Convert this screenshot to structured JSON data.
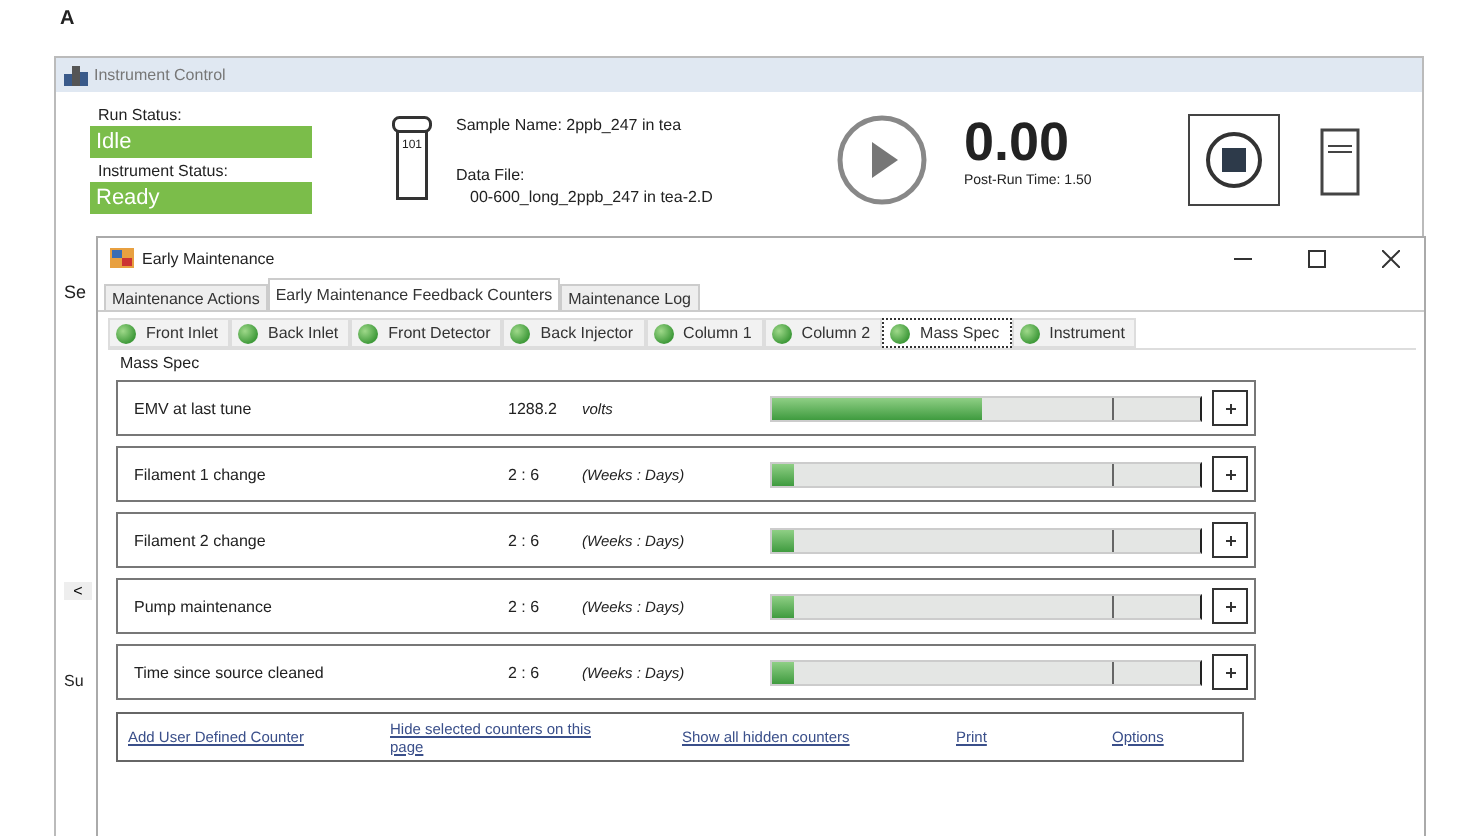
{
  "figure_label": "A",
  "window": {
    "title": "Instrument Control"
  },
  "run_status": {
    "label": "Run Status:",
    "value": "Idle"
  },
  "instrument_status": {
    "label": "Instrument Status:",
    "value": "Ready"
  },
  "vial": {
    "number": "101"
  },
  "sample_name": "Sample Name: 2ppb_247 in tea",
  "data_file": {
    "label": "Data File:",
    "value": "00-600_long_2ppb_247 in tea-2.D"
  },
  "timer": {
    "value": "0.00",
    "post_run": "Post-Run Time: 1.50"
  },
  "background_fragments": {
    "top": "Se",
    "scroll": "<",
    "bottom": "Su"
  },
  "dialog": {
    "title": "Early Maintenance",
    "tabs": [
      {
        "label": "Maintenance Actions",
        "selected": false
      },
      {
        "label": "Early Maintenance Feedback Counters",
        "selected": true
      },
      {
        "label": "Maintenance Log",
        "selected": false
      }
    ],
    "module_tabs": [
      {
        "label": "Front Inlet",
        "selected": false
      },
      {
        "label": "Back Inlet",
        "selected": false
      },
      {
        "label": "Front Detector",
        "selected": false
      },
      {
        "label": "Back Injector",
        "selected": false
      },
      {
        "label": "Column 1",
        "selected": false
      },
      {
        "label": "Column 2",
        "selected": false
      },
      {
        "label": "Mass Spec",
        "selected": true
      },
      {
        "label": "Instrument",
        "selected": false
      }
    ],
    "panel_title": "Mass Spec",
    "counters": [
      {
        "name": "EMV at last tune",
        "value": "1288.2",
        "unit": "volts",
        "level": 0.49
      },
      {
        "name": "Filament 1 change",
        "value": "2 : 6",
        "unit": "(Weeks : Days)",
        "level": 0.05
      },
      {
        "name": "Filament 2 change",
        "value": "2 : 6",
        "unit": "(Weeks : Days)",
        "level": 0.05
      },
      {
        "name": "Pump maintenance",
        "value": "2 : 6",
        "unit": "(Weeks : Days)",
        "level": 0.05
      },
      {
        "name": "Time since source cleaned",
        "value": "2 : 6",
        "unit": "(Weeks : Days)",
        "level": 0.05
      }
    ],
    "links": [
      "Add User Defined Counter",
      "Hide selected counters on this page",
      "Show all hidden counters",
      "Print",
      "Options"
    ]
  }
}
